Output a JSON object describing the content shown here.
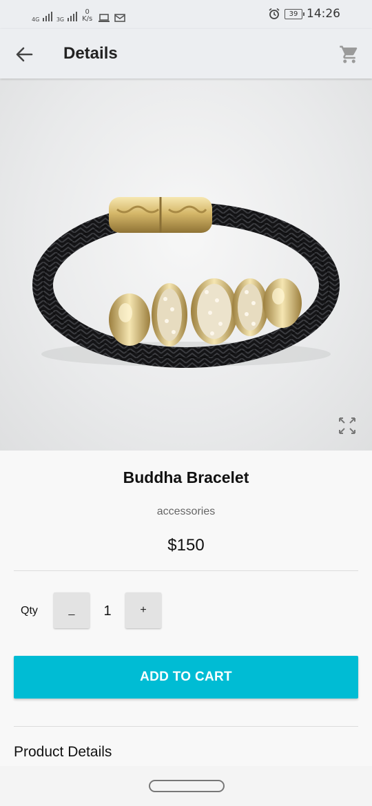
{
  "status_bar": {
    "network_1": "4G",
    "network_2": "3G",
    "speed_value": "0",
    "speed_unit": "K/s",
    "battery": "39",
    "time": "14:26",
    "icons": [
      "laptop-icon",
      "mail-icon",
      "alarm-icon"
    ]
  },
  "app_bar": {
    "title": "Details",
    "back_icon": "arrow-left-icon",
    "cart_icon": "shopping-cart-icon"
  },
  "product": {
    "image_subject": "bracelet-image",
    "name": "Buddha Bracelet",
    "category": "accessories",
    "price": "$150"
  },
  "quantity": {
    "label": "Qty",
    "decrement": "_",
    "value": "1",
    "increment": "+"
  },
  "actions": {
    "add_to_cart": "ADD TO CART"
  },
  "sections": {
    "product_details": "Product Details"
  },
  "colors": {
    "accent": "#00bcd4",
    "app_bar_bg": "#eceef1"
  }
}
